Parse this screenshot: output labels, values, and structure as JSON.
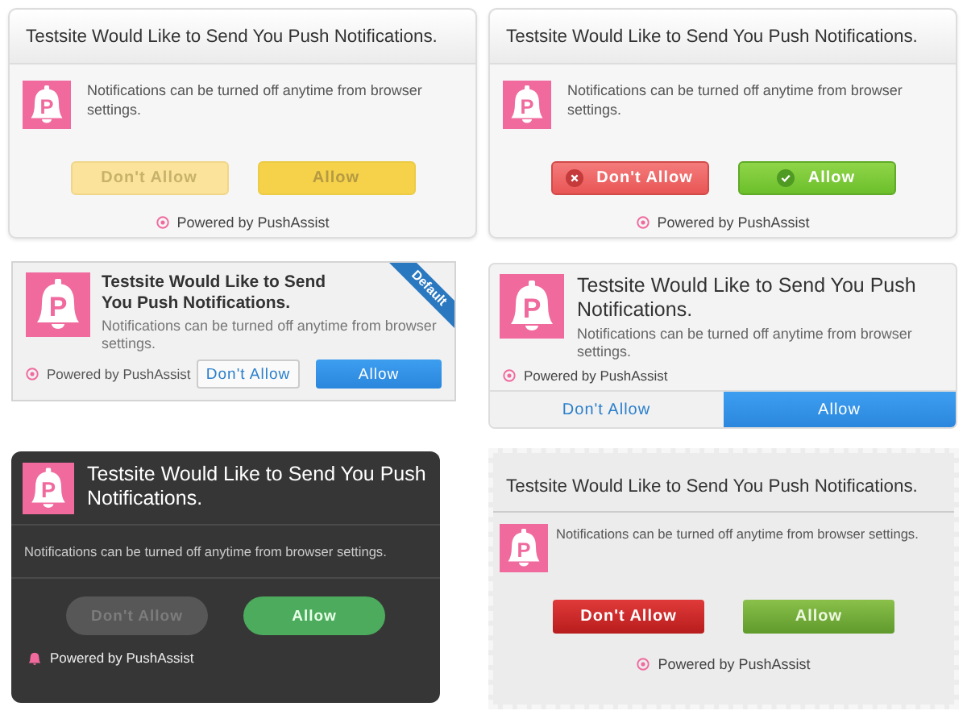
{
  "panels": [
    {
      "kind": "yellow",
      "logo": "P",
      "title": "Testsite Would Like to Send You Push Notifications.",
      "message": "Notifications can be turned off anytime from browser settings.",
      "buttons": [
        {
          "label": "Don't Allow",
          "kind": "deny"
        },
        {
          "label": "Allow",
          "kind": "allow"
        }
      ],
      "powered_by": "Powered by PushAssist"
    },
    {
      "kind": "redgreen",
      "logo": "P",
      "title": "Testsite Would Like to Send You Push Notifications.",
      "message": "Notifications can be turned off anytime from browser settings.",
      "buttons": [
        {
          "label": "Don't Allow",
          "kind": "deny"
        },
        {
          "label": "Allow",
          "kind": "allow"
        }
      ],
      "powered_by": "Powered by PushAssist"
    },
    {
      "kind": "ribbon",
      "logo": "P",
      "badge": "Default",
      "title": "Testsite Would Like to Send You Push Notifications.",
      "message": "Notifications can be turned off anytime from browser settings.",
      "buttons": [
        {
          "label": "Don't Allow",
          "kind": "deny"
        },
        {
          "label": "Allow",
          "kind": "allow"
        }
      ],
      "powered_by": "Powered by PushAssist"
    },
    {
      "kind": "bar",
      "logo": "P",
      "title": "Testsite Would Like to Send You Push Notifications.",
      "message": "Notifications can be turned off anytime from browser settings.",
      "buttons": [
        {
          "label": "Don't Allow",
          "kind": "deny"
        },
        {
          "label": "Allow",
          "kind": "allow"
        }
      ],
      "powered_by": "Powered by PushAssist"
    },
    {
      "kind": "dark",
      "logo": "P",
      "title": "Testsite Would Like to Send You Push Notifications.",
      "message": "Notifications can be turned off anytime from browser settings.",
      "buttons": [
        {
          "label": "Don't Allow",
          "kind": "deny"
        },
        {
          "label": "Allow",
          "kind": "allow"
        }
      ],
      "powered_by": "Powered by PushAssist"
    },
    {
      "kind": "gloss",
      "logo": "P",
      "title": "Testsite Would Like to Send You Push Notifications.",
      "message": "Notifications can be turned off anytime from browser settings.",
      "buttons": [
        {
          "label": "Don't Allow",
          "kind": "deny"
        },
        {
          "label": "Allow",
          "kind": "allow"
        }
      ],
      "powered_by": "Powered by PushAssist"
    }
  ]
}
